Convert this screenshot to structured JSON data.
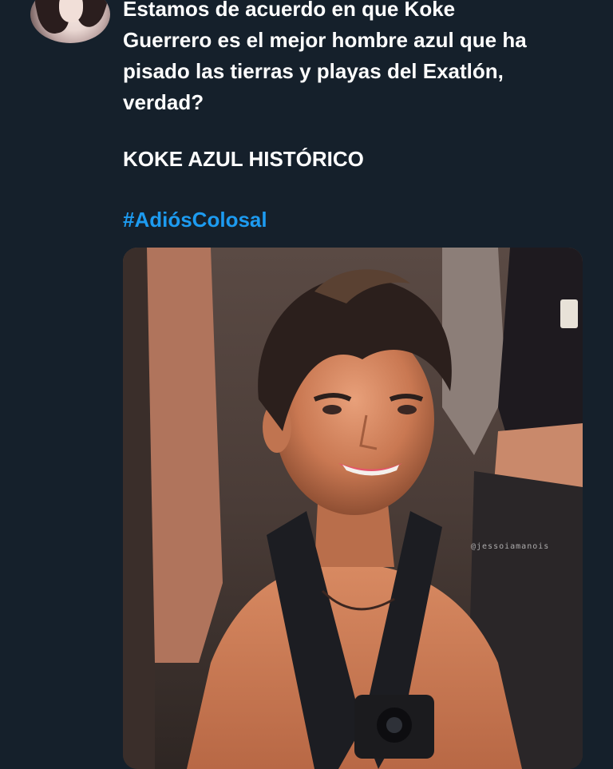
{
  "tweet": {
    "lines": [
      "Estamos de acuerdo en que Koke",
      "Guerrero es el mejor hombre azul que ha",
      "pisado las tierras y playas del Exatlón,",
      "verdad?"
    ],
    "headline": "KOKE AZUL HISTÓRICO",
    "hashtag": "#AdiósColosal"
  },
  "media": {
    "watermark": "@jessoiamanois"
  },
  "colors": {
    "background": "#15202b",
    "text": "#ffffff",
    "hashtag": "#1d9bf0"
  }
}
